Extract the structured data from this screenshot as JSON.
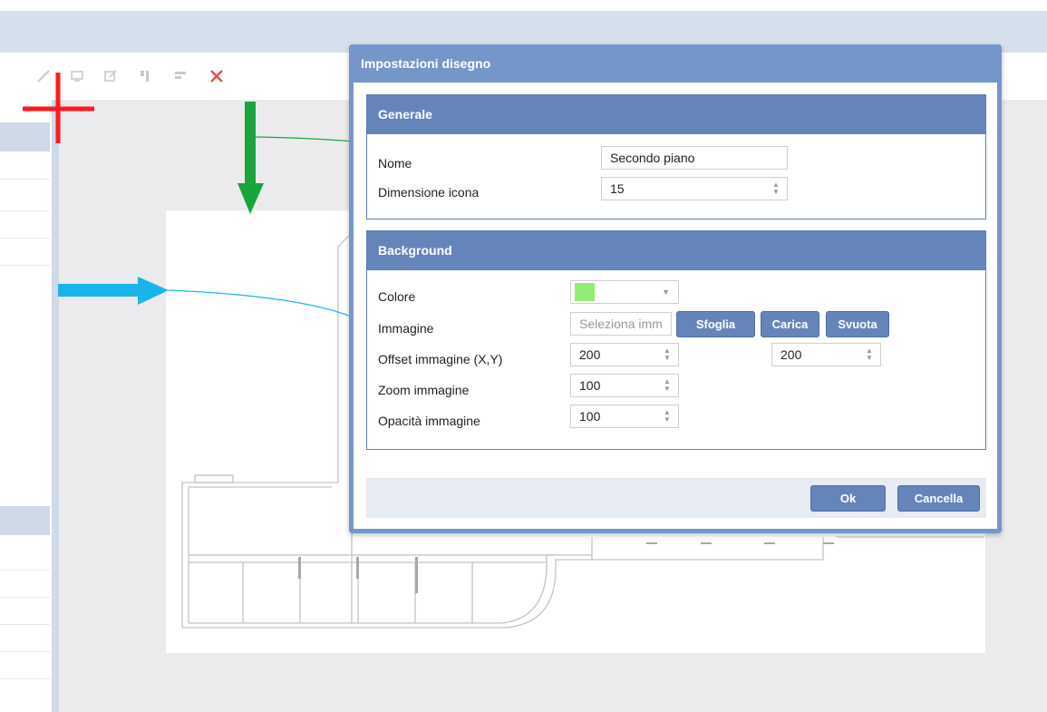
{
  "dialog": {
    "title": "Impostazioni disegno",
    "general": {
      "title": "Generale",
      "name_label": "Nome",
      "name_value": "Secondo piano",
      "icon_size_label": "Dimensione icona",
      "icon_size_value": "15"
    },
    "background": {
      "title": "Background",
      "color_label": "Colore",
      "color_value": "#90ee72",
      "image_label": "Immagine",
      "image_placeholder": "Seleziona imm",
      "browse_button": "Sfoglia",
      "upload_button": "Carica",
      "clear_button": "Svuota",
      "offset_label": "Offset immagine (X,Y)",
      "offset_x": "200",
      "offset_y": "200",
      "zoom_label": "Zoom immagine",
      "zoom_value": "100",
      "opacity_label": "Opacità immagine",
      "opacity_value": "100"
    },
    "ok_button": "Ok",
    "cancel_button": "Cancella"
  },
  "toolbar": {
    "icons": [
      "line-tool-icon",
      "monitor-icon",
      "edit-icon",
      "align-icon",
      "align-top-icon",
      "delete-icon"
    ]
  },
  "annotations": {
    "cross_color": "#ff1a1a",
    "green_arrow_color": "#17a63d",
    "blue_arrow_color": "#1ab4ea"
  }
}
